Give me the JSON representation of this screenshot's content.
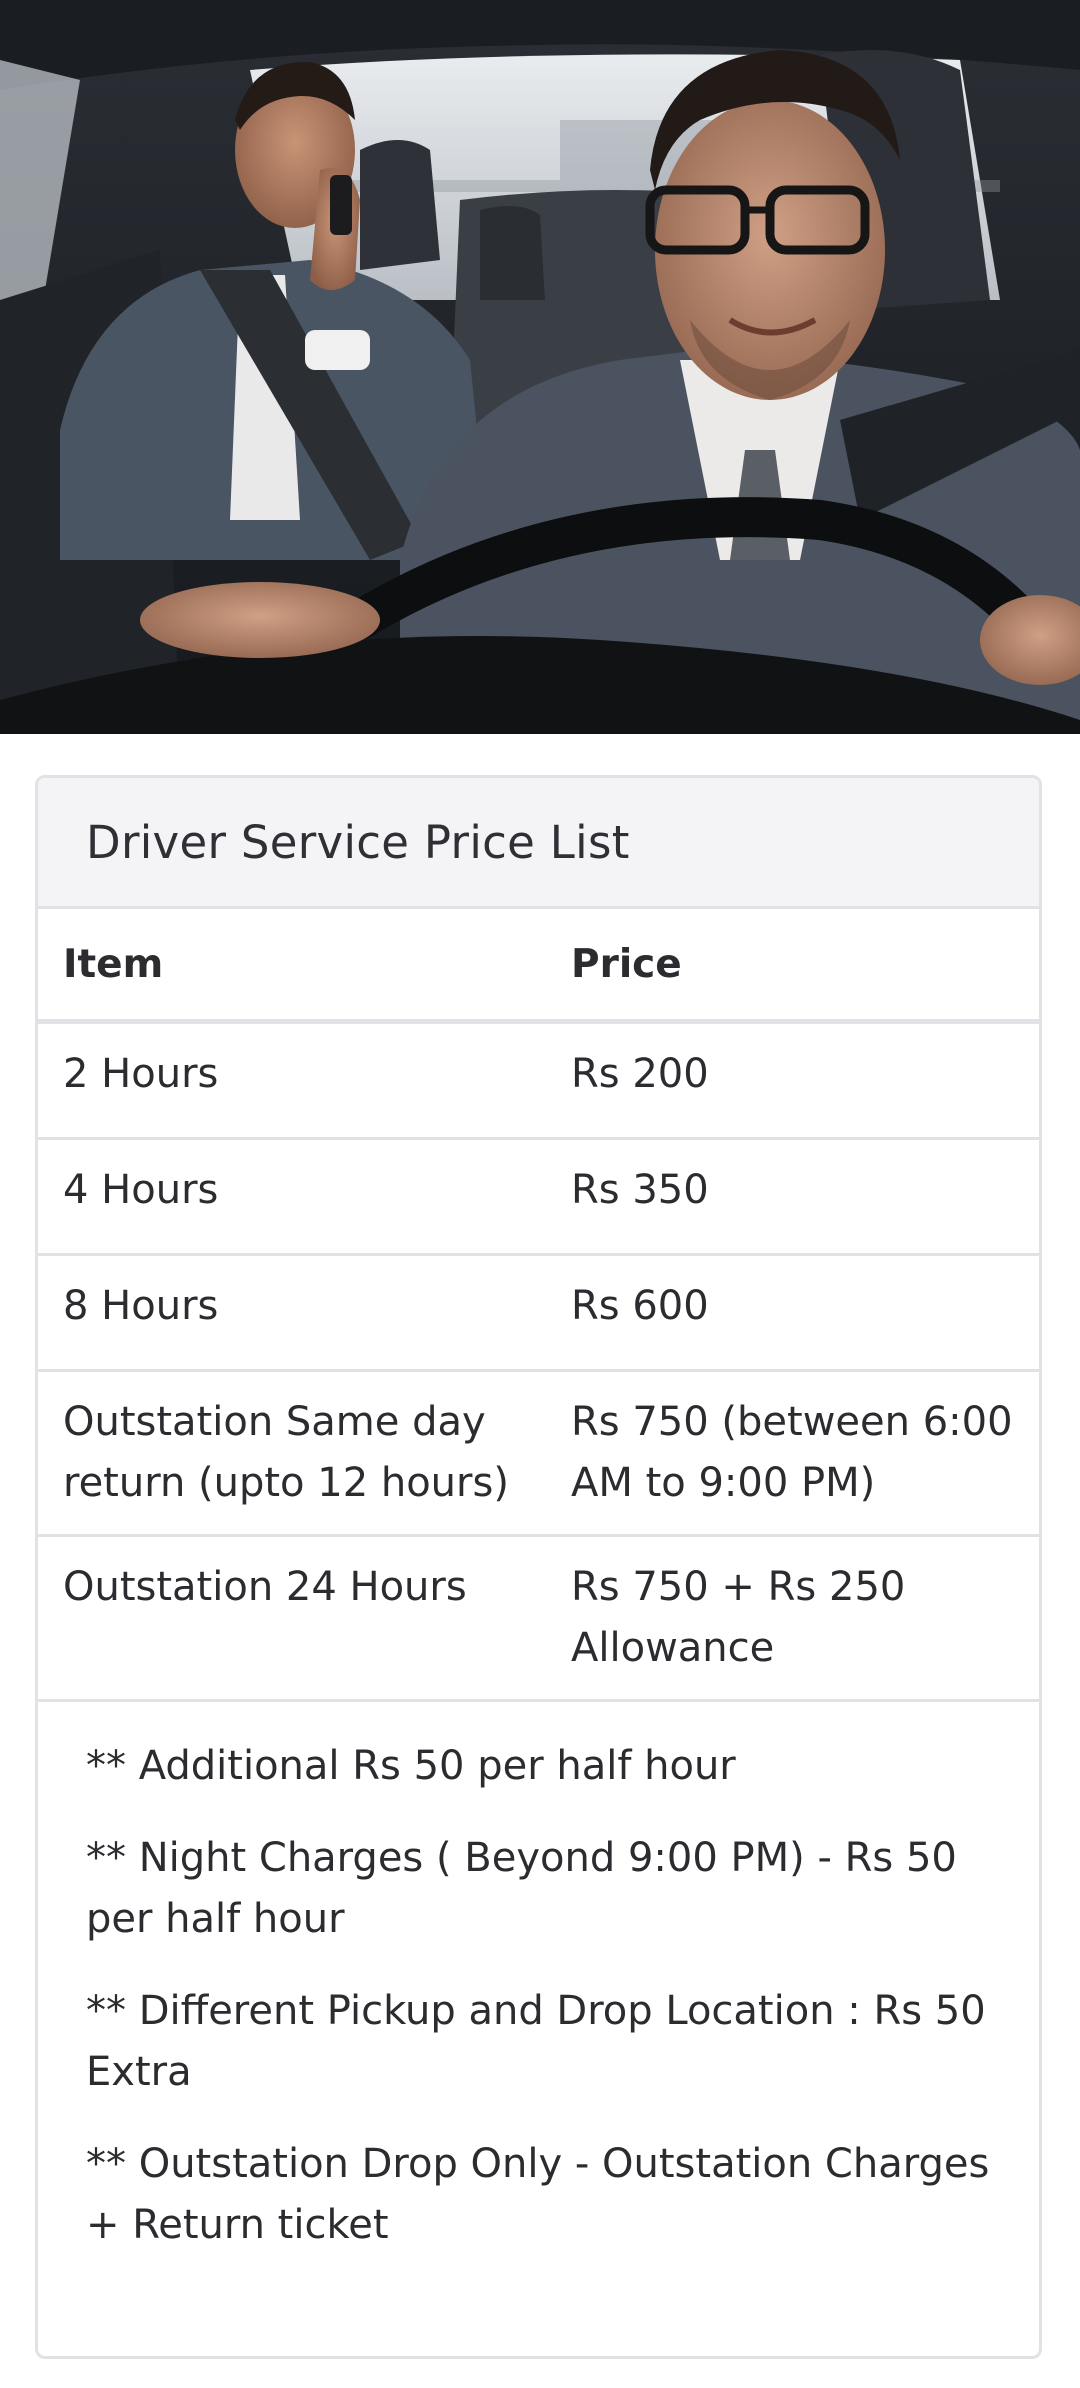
{
  "hero": {
    "image": "driver-with-passenger-photo"
  },
  "price_card": {
    "title": "Driver Service Price List",
    "columns": {
      "item": "Item",
      "price": "Price"
    },
    "rows": [
      {
        "item": "2 Hours",
        "price": "Rs 200"
      },
      {
        "item": "4 Hours",
        "price": "Rs 350"
      },
      {
        "item": "8 Hours",
        "price": "Rs 600"
      },
      {
        "item": "Outstation Same day return (upto 12 hours)",
        "price": "Rs 750 (between 6:00 AM to 9:00 PM)"
      },
      {
        "item": "Outstation 24 Hours",
        "price": "Rs 750 + Rs 250 Allowance"
      }
    ],
    "notes": [
      "** Additional Rs 50 per half hour",
      "** Night Charges ( Beyond 9:00 PM) - Rs 50 per half hour",
      "** Different Pickup and Drop Location : Rs 50 Extra",
      "** Outstation Drop Only - Outstation Charges + Return ticket"
    ]
  }
}
